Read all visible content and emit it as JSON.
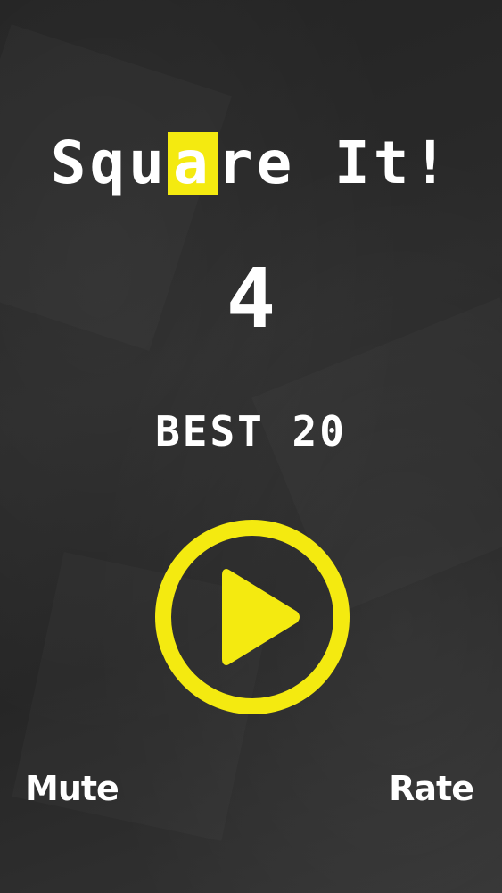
{
  "title": {
    "before": "Squ",
    "highlight": "a",
    "after": "re It!"
  },
  "score": "4",
  "best": {
    "label": "BEST",
    "value": "20"
  },
  "play_button": {
    "icon": "play-icon",
    "color": "#f4ea10"
  },
  "footer": {
    "mute_label": "Mute",
    "rate_label": "Rate"
  },
  "colors": {
    "accent": "#f4ea10",
    "background": "#2a2a2a",
    "text": "#ffffff"
  }
}
